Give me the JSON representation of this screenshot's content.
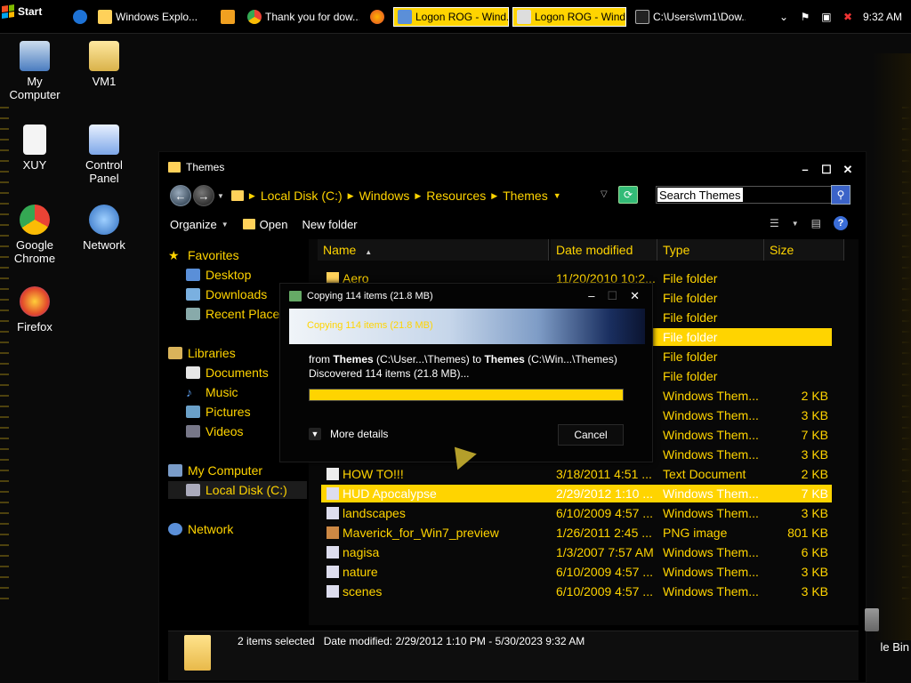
{
  "taskbar": {
    "start_label": "Start",
    "items": [
      {
        "label": "Windows Explo...",
        "active": false
      },
      {
        "label": "Thank you for dow...",
        "active": false
      },
      {
        "label": "Logon ROG - Wind...",
        "active": true
      },
      {
        "label": "Logon ROG - Wind...",
        "active": true
      },
      {
        "label": "C:\\Users\\vm1\\Dow...",
        "active": false
      }
    ],
    "clock": "9:32 AM"
  },
  "desktop": {
    "icons": [
      {
        "label": "My Computer"
      },
      {
        "label": "VM1"
      },
      {
        "label": "XUY"
      },
      {
        "label": "Control Panel"
      },
      {
        "label": "Google Chrome"
      },
      {
        "label": "Network"
      },
      {
        "label": "Firefox"
      },
      {
        "label": "le Bin"
      }
    ]
  },
  "explorer": {
    "title": "Themes",
    "breadcrumb": [
      "Local Disk (C:)",
      "Windows",
      "Resources",
      "Themes"
    ],
    "search_placeholder": "Search Themes",
    "toolbar": {
      "organize": "Organize",
      "open": "Open",
      "new_folder": "New folder"
    },
    "nav": {
      "favorites": "Favorites",
      "desktop": "Desktop",
      "downloads": "Downloads",
      "recent": "Recent Places",
      "libraries": "Libraries",
      "documents": "Documents",
      "music": "Music",
      "pictures": "Pictures",
      "videos": "Videos",
      "my_computer": "My Computer",
      "local_disk": "Local Disk (C:)",
      "network": "Network"
    },
    "columns": {
      "name": "Name",
      "date": "Date modified",
      "type": "Type",
      "size": "Size"
    },
    "files": [
      {
        "name": "Aero",
        "date": "11/20/2010 10:2...",
        "type": "File folder",
        "size": "",
        "selected": false
      },
      {
        "name": "",
        "date": "",
        "type": "File folder",
        "size": "",
        "selected": false
      },
      {
        "name": "",
        "date": "",
        "type": "File folder",
        "size": "",
        "selected": false
      },
      {
        "name": "",
        "date": "",
        "type": "File folder",
        "size": "",
        "selected": true
      },
      {
        "name": "",
        "date": "",
        "type": "File folder",
        "size": "",
        "selected": false
      },
      {
        "name": "",
        "date": "",
        "type": "File folder",
        "size": "",
        "selected": false
      },
      {
        "name": "",
        "date": "",
        "type": "Windows Them...",
        "size": "2 KB",
        "selected": false
      },
      {
        "name": "",
        "date": "",
        "type": "Windows Them...",
        "size": "3 KB",
        "selected": false
      },
      {
        "name": "",
        "date": "",
        "type": "Windows Them...",
        "size": "7 KB",
        "selected": false
      },
      {
        "name": "",
        "date": "",
        "type": "Windows Them...",
        "size": "3 KB",
        "selected": false
      },
      {
        "name": "HOW TO!!!",
        "date": "3/18/2011 4:51 ...",
        "type": "Text Document",
        "size": "2 KB",
        "selected": false
      },
      {
        "name": "HUD Apocalypse",
        "date": "2/29/2012 1:10 ...",
        "type": "Windows Them...",
        "size": "7 KB",
        "selected": true
      },
      {
        "name": "landscapes",
        "date": "6/10/2009 4:57 ...",
        "type": "Windows Them...",
        "size": "3 KB",
        "selected": false
      },
      {
        "name": "Maverick_for_Win7_preview",
        "date": "1/26/2011 2:45 ...",
        "type": "PNG image",
        "size": "801 KB",
        "selected": false
      },
      {
        "name": "nagisa",
        "date": "1/3/2007 7:57 AM",
        "type": "Windows Them...",
        "size": "6 KB",
        "selected": false
      },
      {
        "name": "nature",
        "date": "6/10/2009 4:57 ...",
        "type": "Windows Them...",
        "size": "3 KB",
        "selected": false
      },
      {
        "name": "scenes",
        "date": "6/10/2009 4:57 ...",
        "type": "Windows Them...",
        "size": "3 KB",
        "selected": false
      }
    ],
    "details": {
      "selected_text": "2 items selected",
      "date_label": "Date modified:",
      "date_value": "2/29/2012 1:10 PM - 5/30/2023 9:32 AM"
    }
  },
  "copy_dialog": {
    "title": "Copying 114 items (21.8 MB)",
    "banner": "Copying 114 items (21.8 MB)",
    "from_word": "from",
    "src_name": "Themes",
    "src_path": "(C:\\User...\\Themes)",
    "to_word": "to",
    "dst_name": "Themes",
    "dst_path": "(C:\\Win...\\Themes)",
    "discovered": "Discovered 114 items (21.8 MB)...",
    "progress": 1.0,
    "more_details": "More details",
    "cancel": "Cancel"
  },
  "colors": {
    "accent": "#ffd400",
    "background": "#000000"
  }
}
